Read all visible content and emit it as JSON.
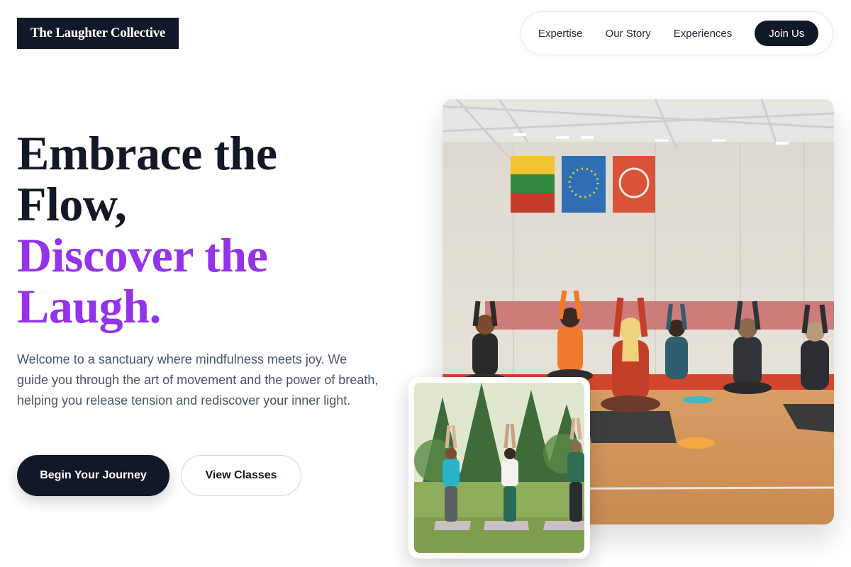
{
  "header": {
    "logo": "The Laughter Collective",
    "nav": [
      "Expertise",
      "Our Story",
      "Experiences"
    ],
    "cta": "Join Us"
  },
  "hero": {
    "headline_line1": "Embrace the",
    "headline_line2": "Flow,",
    "headline_line3": "Discover the",
    "headline_line4": "Laugh.",
    "intro": "Welcome to a sanctuary where mindfulness meets joy. We guide you through the art of movement and the power of breath, helping you release tension and rediscover your inner light.",
    "primary_button": "Begin Your Journey",
    "secondary_button": "View Classes"
  },
  "colors": {
    "dark": "#111827",
    "accent": "#9333ea",
    "body_text": "#475569"
  }
}
